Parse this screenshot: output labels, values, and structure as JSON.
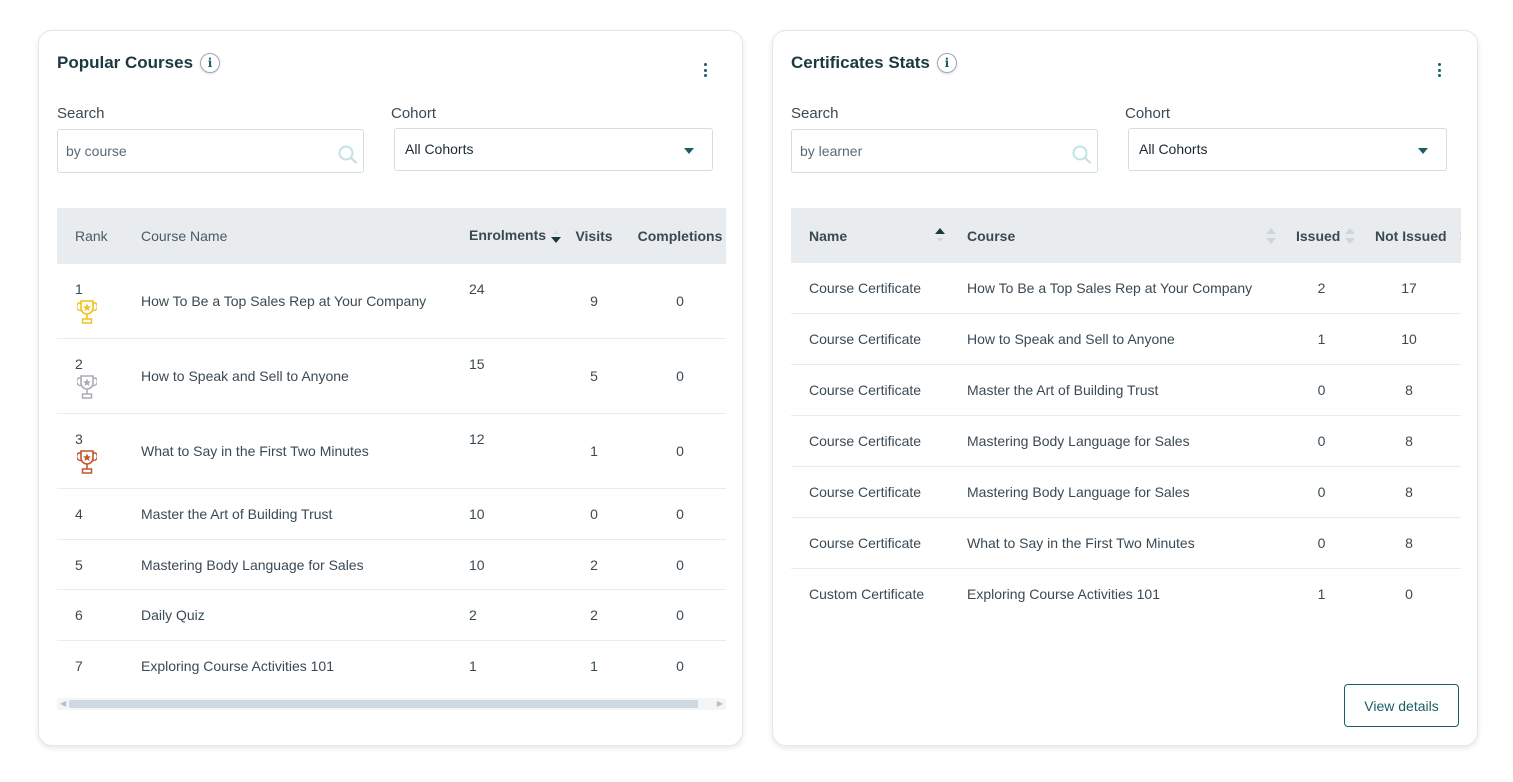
{
  "popular": {
    "title": "Popular Courses",
    "info": "i",
    "search_label": "Search",
    "search_placeholder": "by course",
    "cohort_label": "Cohort",
    "cohort_value": "All Cohorts",
    "columns": {
      "rank": "Rank",
      "course": "Course Name",
      "enrolments": "Enrolments",
      "visits": "Visits",
      "completions": "Completions"
    },
    "rows": [
      {
        "rank": "1",
        "course": "How To Be a Top Sales Rep at Your Company",
        "enrolments": "24",
        "visits": "9",
        "completions": "0",
        "trophy": "gold-trophy-icon"
      },
      {
        "rank": "2",
        "course": "How to Speak and Sell to Anyone",
        "enrolments": "15",
        "visits": "5",
        "completions": "0",
        "trophy": "silver-trophy-icon"
      },
      {
        "rank": "3",
        "course": "What to Say in the First Two Minutes",
        "enrolments": "12",
        "visits": "1",
        "completions": "0",
        "trophy": "bronze-trophy-icon"
      },
      {
        "rank": "4",
        "course": "Master the Art of Building Trust",
        "enrolments": "10",
        "visits": "0",
        "completions": "0"
      },
      {
        "rank": "5",
        "course": "Mastering Body Language for Sales",
        "enrolments": "10",
        "visits": "2",
        "completions": "0"
      },
      {
        "rank": "6",
        "course": "Daily Quiz",
        "enrolments": "2",
        "visits": "2",
        "completions": "0"
      },
      {
        "rank": "7",
        "course": "Exploring Course Activities 101",
        "enrolments": "1",
        "visits": "1",
        "completions": "0"
      }
    ]
  },
  "certs": {
    "title": "Certificates Stats",
    "info": "i",
    "search_label": "Search",
    "search_placeholder": "by learner",
    "cohort_label": "Cohort",
    "cohort_value": "All Cohorts",
    "columns": {
      "name": "Name",
      "course": "Course",
      "issued": "Issued",
      "not_issued": "Not Issued"
    },
    "rows": [
      {
        "name": "Course Certificate",
        "course": "How To Be a Top Sales Rep at Your Company",
        "issued": "2",
        "not_issued": "17"
      },
      {
        "name": "Course Certificate",
        "course": "How to Speak and Sell to Anyone",
        "issued": "1",
        "not_issued": "10"
      },
      {
        "name": "Course Certificate",
        "course": "Master the Art of Building Trust",
        "issued": "0",
        "not_issued": "8"
      },
      {
        "name": "Course Certificate",
        "course": "Mastering Body Language for Sales",
        "issued": "0",
        "not_issued": "8"
      },
      {
        "name": "Course Certificate",
        "course": "Mastering Body Language for Sales",
        "issued": "0",
        "not_issued": "8"
      },
      {
        "name": "Course Certificate",
        "course": "What to Say in the First Two Minutes",
        "issued": "0",
        "not_issued": "8"
      },
      {
        "name": "Custom Certificate",
        "course": "Exploring Course Activities 101",
        "issued": "1",
        "not_issued": "0"
      }
    ],
    "view_details": "View details"
  },
  "colors": {
    "accent": "#1b5f66",
    "header_bg": "#e8ecef",
    "gold": "#f2c21a",
    "silver": "#a9adb2",
    "bronze": "#c0562a"
  }
}
